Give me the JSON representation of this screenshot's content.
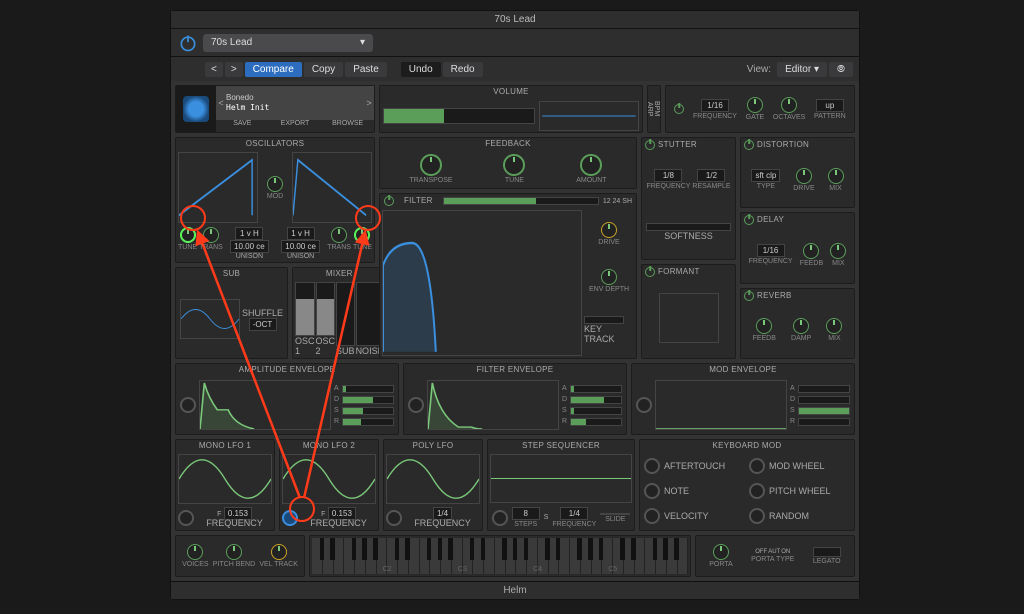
{
  "window_title": "70s Lead",
  "preset_name": "70s Lead",
  "toolbar": {
    "back": "<",
    "fwd": ">",
    "compare": "Compare",
    "copy": "Copy",
    "paste": "Paste",
    "undo": "Undo",
    "redo": "Redo",
    "view_label": "View:",
    "view_value": "Editor"
  },
  "patch": {
    "bank": "Bonedo",
    "name": "Helm Init",
    "save": "SAVE",
    "export": "EXPORT",
    "browse": "BROWSE"
  },
  "volume": {
    "title": "VOLUME"
  },
  "bpm_arp": {
    "bpm": "BPM",
    "arp": "ARP"
  },
  "arp": {
    "tempo": "1/16",
    "freq": "FREQUENCY",
    "gate": "GATE",
    "octaves": "OCTAVES",
    "pattern_btn": "up",
    "pattern": "PATTERN"
  },
  "osc": {
    "title": "OSCILLATORS",
    "mod": "MOD",
    "tune": "TUNE",
    "trans": "TRANS",
    "unison_v": "1 v H",
    "unison_d": "10.00 ce",
    "unison": "UNISON"
  },
  "feedback": {
    "title": "FEEDBACK",
    "transpose": "TRANSPOSE",
    "tune": "TUNE",
    "amount": "AMOUNT"
  },
  "stutter": {
    "title": "STUTTER",
    "freq": "FREQUENCY",
    "resample": "RESAMPLE",
    "v1": "1/8",
    "v2": "1/2",
    "softness": "SOFTNESS"
  },
  "distortion": {
    "title": "DISTORTION",
    "type_val": "sft clp",
    "type": "TYPE",
    "drive": "DRIVE",
    "mix": "MIX"
  },
  "sub": {
    "title": "SUB",
    "shuffle": "SHUFFLE",
    "oct": "-OCT"
  },
  "mixer": {
    "title": "MIXER",
    "osc1": "OSC 1",
    "osc2": "OSC 2",
    "sub": "SUB",
    "noise": "NOISE"
  },
  "filter": {
    "title": "FILTER",
    "modes": "12 24 SH",
    "drive": "DRIVE",
    "env": "ENV DEPTH",
    "key": "KEY TRACK"
  },
  "formant": {
    "title": "FORMANT"
  },
  "delay": {
    "title": "DELAY",
    "freq_val": "1/16",
    "freq": "FREQUENCY",
    "feedb": "FEEDB",
    "mix": "MIX"
  },
  "reverb": {
    "title": "REVERB",
    "feedb": "FEEDB",
    "damp": "DAMP",
    "mix": "MIX"
  },
  "env": {
    "amp": "AMPLITUDE ENVELOPE",
    "filt": "FILTER ENVELOPE",
    "mod": "MOD ENVELOPE",
    "a": "A",
    "d": "D",
    "s": "S",
    "r": "R",
    "freq": "FREQUENCY"
  },
  "lfo": {
    "mono1": "MONO LFO 1",
    "mono2": "MONO LFO 2",
    "poly": "POLY LFO",
    "freq_sym": "F",
    "freq_val": "0.153",
    "freq": "FREQUENCY",
    "poly_freq": "1/4"
  },
  "step": {
    "title": "STEP SEQUENCER",
    "steps_val": "8",
    "steps": "STEPS",
    "s": "S",
    "freq_val": "1/4",
    "freq": "FREQUENCY",
    "slide": "SLIDE"
  },
  "kbd": {
    "title": "KEYBOARD MOD",
    "aftertouch": "AFTERTOUCH",
    "note": "NOTE",
    "velocity": "VELOCITY",
    "modwheel": "MOD WHEEL",
    "pitchwheel": "PITCH WHEEL",
    "random": "RANDOM"
  },
  "bottom": {
    "voices": "VOICES",
    "pitchbend": "PITCH BEND",
    "veltrack": "VEL TRACK",
    "c2": "C2",
    "c3": "C3",
    "c4": "C4",
    "c5": "C5",
    "porta": "PORTA",
    "portatype": "PORTA TYPE",
    "off": "OFF",
    "aut": "AUT",
    "on": "ON",
    "legato": "LEGATO"
  },
  "footer": "Helm"
}
